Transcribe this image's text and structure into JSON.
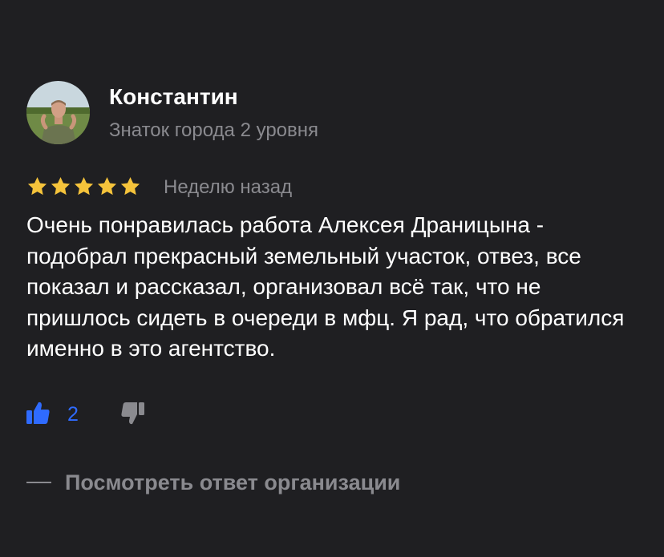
{
  "author": {
    "name": "Константин",
    "level": "Знаток города 2 уровня",
    "avatar_icon": "user-photo"
  },
  "rating": {
    "stars": 5,
    "max": 5,
    "star_color": "#f5c33b"
  },
  "review": {
    "date": "Неделю назад",
    "text": "Очень понравилась работа Алексея Драницына - подобрал прекрасный земельный участок, отвез, все показал и рассказал, организовал всё так, что не пришлось сидеть в очереди в мфц. Я рад, что обратился именно в это агентство."
  },
  "reactions": {
    "like_icon": "thumbs-up-icon",
    "like_count": "2",
    "like_color": "#2f6bff",
    "dislike_icon": "thumbs-down-icon"
  },
  "org_reply": {
    "label": "Посмотреть ответ организации"
  },
  "colors": {
    "background": "#1f1f22",
    "text_primary": "#ffffff",
    "text_secondary": "#8a8a8f"
  }
}
